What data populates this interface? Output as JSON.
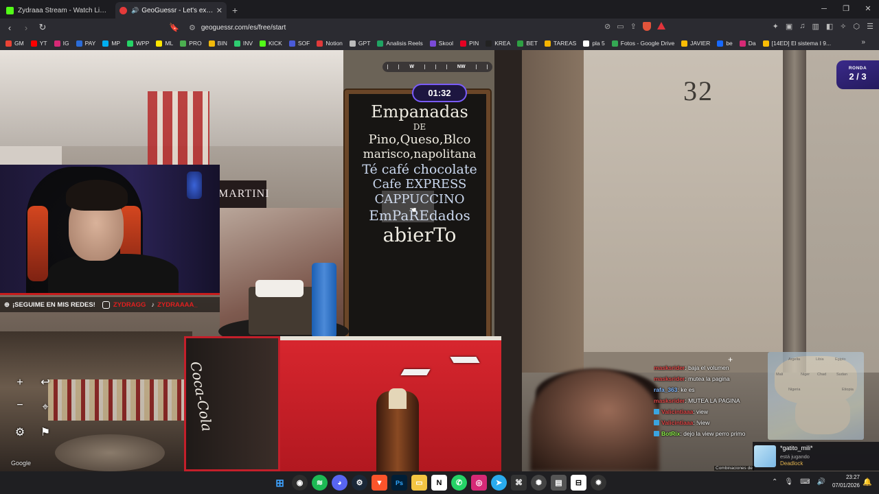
{
  "browser": {
    "tabs": [
      {
        "title": "Zydraaa Stream - Watch Live on Kick",
        "favicon_color": "#53fc18",
        "active": false
      },
      {
        "title": "GeoGuessr - Let's explore the",
        "favicon_color": "#e43a3a",
        "active": true
      }
    ],
    "new_tab": "+",
    "url": "geoguessr.com/es/free/start",
    "bookmarks": [
      {
        "label": "GM",
        "color": "#ea4335"
      },
      {
        "label": "YT",
        "color": "#ff0000"
      },
      {
        "label": "IG",
        "color": "#d62976"
      },
      {
        "label": "PAY",
        "color": "#2b6cd8"
      },
      {
        "label": "MP",
        "color": "#00aeef"
      },
      {
        "label": "WPP",
        "color": "#25d366"
      },
      {
        "label": "ML",
        "color": "#ffe600"
      },
      {
        "label": "PRO",
        "color": "#4caf50"
      },
      {
        "label": "BIN",
        "color": "#f0b90b"
      },
      {
        "label": "INV",
        "color": "#2ecc71"
      },
      {
        "label": "KICK",
        "color": "#53fc18"
      },
      {
        "label": "SOF",
        "color": "#4a5bd8"
      },
      {
        "label": "Notion",
        "color": "#e03a3a"
      },
      {
        "label": "GPT",
        "color": "#bbbbbb"
      },
      {
        "label": "Analisis Reels",
        "color": "#1fa463"
      },
      {
        "label": "Skool",
        "color": "#7a4ad8"
      },
      {
        "label": "PIN",
        "color": "#e60023"
      },
      {
        "label": "KREA",
        "color": "#222222"
      },
      {
        "label": "BET",
        "color": "#2ea043"
      },
      {
        "label": "TAREAS",
        "color": "#f4b400"
      },
      {
        "label": "pla 5",
        "color": "#ffffff"
      },
      {
        "label": "Fotos - Google Drive",
        "color": "#34a853"
      },
      {
        "label": "JAVIER",
        "color": "#fbbc05"
      },
      {
        "label": "be",
        "color": "#1769ff"
      },
      {
        "label": "Da",
        "color": "#d62976"
      },
      {
        "label": "[14ED] El sistema I 9...",
        "color": "#fbbc05"
      }
    ]
  },
  "game": {
    "compass": {
      "west": "W",
      "northwest": "NW"
    },
    "timer": "01:32",
    "round_label": "RONDA",
    "round_value": "2 / 3",
    "street_number": "32",
    "attribution": "Google",
    "board_lines": [
      "Empanadas",
      "DE",
      "Pino,Queso,Blco",
      "marisco,napolitana",
      "Té café chocolate",
      "Cafe EXPRESS",
      "CAPPUCCINO",
      "EmPaREdados",
      "abierTo"
    ],
    "martini": "MARTINI",
    "coca_cola": "Coca-Cola"
  },
  "stream": {
    "social_text": "¡SEGUIME EN MIS REDES!",
    "instagram": "ZYDRAGG",
    "tiktok": "ZYDRAAAA_",
    "chat": [
      {
        "user": "masksrider",
        "user_color": "#e04848",
        "text": ": baja el volumen",
        "badge": false
      },
      {
        "user": "masksrider",
        "user_color": "#e04848",
        "text": ": mutea la pagina",
        "badge": false
      },
      {
        "user": "rafa_363",
        "user_color": "#7fb7ff",
        "text": ": ke es",
        "badge": false
      },
      {
        "user": "masksrider",
        "user_color": "#e04848",
        "text": ": MUTEA LA PAGINA",
        "badge": false
      },
      {
        "user": "Valicintiaaa",
        "user_color": "#e04848",
        "text": ": view",
        "badge": true
      },
      {
        "user": "Valicintiaaa",
        "user_color": "#e04848",
        "text": ": !view",
        "badge": true
      },
      {
        "user": "BotRix",
        "user_color": "#8ef04a",
        "text": ": dejo la view perro primo",
        "badge": true
      }
    ],
    "minimap_labels": [
      "Argelia",
      "Libia",
      "Egipto",
      "Mali",
      "Niger",
      "Chad",
      "Sudan",
      "Nigeria",
      "Etiopia"
    ],
    "discord": {
      "name": "*gatito_mili*",
      "status": "está jugando",
      "game": "Deadlock"
    },
    "combos": "Combinaciones de"
  },
  "taskbar": {
    "time": "23:27",
    "date": "07/01/2026"
  }
}
